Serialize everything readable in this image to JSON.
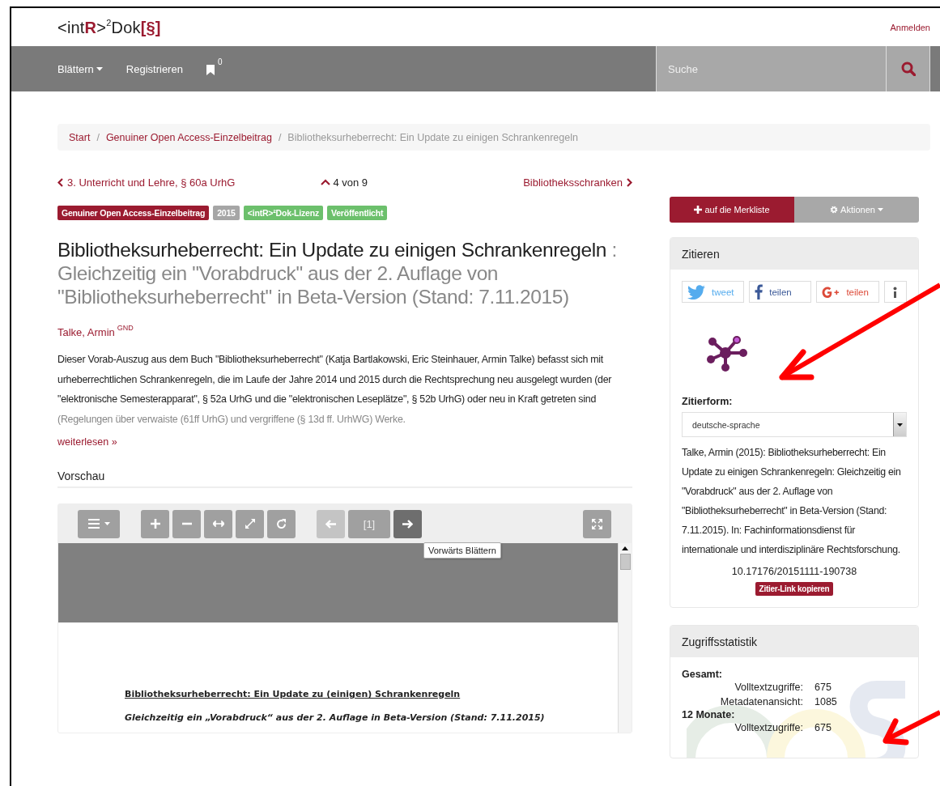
{
  "logo": [
    {
      "text": "<int",
      "kind": "plain"
    },
    {
      "text": "R",
      "kind": "accent"
    },
    {
      "text": ">",
      "kind": "plain"
    },
    {
      "text": "2",
      "kind": "sup"
    },
    {
      "text": "Dok",
      "kind": "plain"
    },
    {
      "text": "[§]",
      "kind": "accent"
    }
  ],
  "login": "Anmelden",
  "nav": {
    "items": [
      {
        "kind": "dropdown",
        "label": "Blättern"
      },
      {
        "kind": "link",
        "label": "Registrieren"
      },
      {
        "kind": "bookmarks",
        "label": "0"
      }
    ],
    "search": {
      "placeholder": "Suche"
    }
  },
  "breadcrumb_separator": "/",
  "breadcrumb": [
    {
      "label": "Start",
      "current": false
    },
    {
      "label": "Genuiner Open Access-Einzelbeitrag",
      "current": false
    },
    {
      "label": "Bibliotheksurheberrecht: Ein Update zu einigen Schrankenregeln",
      "current": true
    }
  ],
  "pager": {
    "previous": "3. Unterricht und Lehre, § 60a UrhG",
    "position": "4 von 9",
    "next": "Bibliotheksschranken"
  },
  "badges": [
    {
      "text": "Genuiner Open Access-Einzelbeitrag",
      "color": "#9b1b30"
    },
    {
      "text": "2015",
      "color": "#a6a6a6"
    },
    {
      "text": "<intR>²Dok-Lizenz",
      "color": "#6cc06c"
    },
    {
      "text": "Veröffentlicht",
      "color": "#6cc06c"
    }
  ],
  "title": "Bibliotheksurheberrecht: Ein Update zu einigen Schrankenregeln",
  "subtitle": ": Gleichzeitig ein \"Vorabdruck\" aus der 2. Auflage von \"Bibliotheksurheberrecht\" in Beta-Version (Stand: 7.11.2015)",
  "author": {
    "name": "Talke, Armin",
    "authority": "GND"
  },
  "abstract": "Dieser Vorab-Auszug aus dem Buch \"Bibliotheksurheberrecht\" (Katja Bartlakowski, Eric Steinhauer, Armin Talke) befasst sich mit urheberrechtlichen Schrankenregeln, die im Laufe der Jahre 2014 und 2015 durch die Rechtsprechung neu ausgelegt wurden (der \"elektronische Semesterapparat\", § 52a UrhG und die \"elektronischen Leseplätze\", § 52b UrhG) oder neu in Kraft getreten sind (Regelungen über verwaiste (61ff UrhG) und vergriffene (§ 13d ff. UrhWG) Werke.",
  "read_more": "weiterlesen »",
  "preview": {
    "heading": "Vorschau",
    "toolbar": [
      {
        "kind": "menu",
        "disabled": false,
        "hovered": false
      },
      {
        "kind": "zoom-in",
        "disabled": false,
        "hovered": false
      },
      {
        "kind": "zoom-out",
        "disabled": false,
        "hovered": false
      },
      {
        "kind": "fit-width",
        "disabled": false,
        "hovered": false
      },
      {
        "kind": "fit-page",
        "disabled": false,
        "hovered": false
      },
      {
        "kind": "rotate",
        "disabled": false,
        "hovered": false
      },
      {
        "kind": "previous",
        "disabled": true,
        "hovered": false
      },
      {
        "kind": "page",
        "label": "[1]",
        "disabled": false,
        "hovered": false
      },
      {
        "kind": "next",
        "disabled": false,
        "hovered": true
      },
      {
        "kind": "fullscreen",
        "disabled": false,
        "hovered": false
      }
    ],
    "tooltip": "Vorwärts Blättern",
    "document": {
      "title": "Bibliotheksurheberrecht: Ein Update zu (einigen) Schrankenregeln",
      "subtitle": "Gleichzeitig ein „Vorabdruck“ aus der 2. Auflage in Beta-Version (Stand: 7.11.2015)"
    }
  },
  "actions": [
    {
      "kind": "primary",
      "label": "auf die Merkliste"
    },
    {
      "kind": "dropdown",
      "label": "Aktionen"
    }
  ],
  "cite": {
    "heading": "Zitieren",
    "share": [
      {
        "kind": "twitter",
        "label": "tweet"
      },
      {
        "kind": "facebook",
        "label": "teilen"
      },
      {
        "kind": "googleplus",
        "label": "teilen"
      },
      {
        "kind": "info"
      }
    ],
    "format_label": "Zitierform:",
    "format": "deutsche-sprache",
    "citation": "Talke, Armin (2015): Bibliotheksurheberrecht: Ein Update zu einigen Schrankenregeln: Gleichzeitig ein \"Vorabdruck\" aus der 2. Auflage von \"Bibliotheksurheberrecht\" in Beta-Version (Stand: 7.11.2015). In: Fachinformationsdienst für internationale und interdisziplinäre Rechtsforschung.",
    "doi": "10.17176/20151111-190738",
    "copy_button": "Zitier-Link kopieren"
  },
  "stats": {
    "heading": "Zugriffsstatistik",
    "groups": [
      {
        "label": "Gesamt:",
        "rows": [
          {
            "label": "Volltextzugriffe:",
            "value": "675"
          },
          {
            "label": "Metadatenansicht:",
            "value": "1085"
          }
        ]
      },
      {
        "label": "12 Monate:",
        "rows": [
          {
            "label": "Volltextzugriffe:",
            "value": "675"
          }
        ]
      }
    ]
  }
}
